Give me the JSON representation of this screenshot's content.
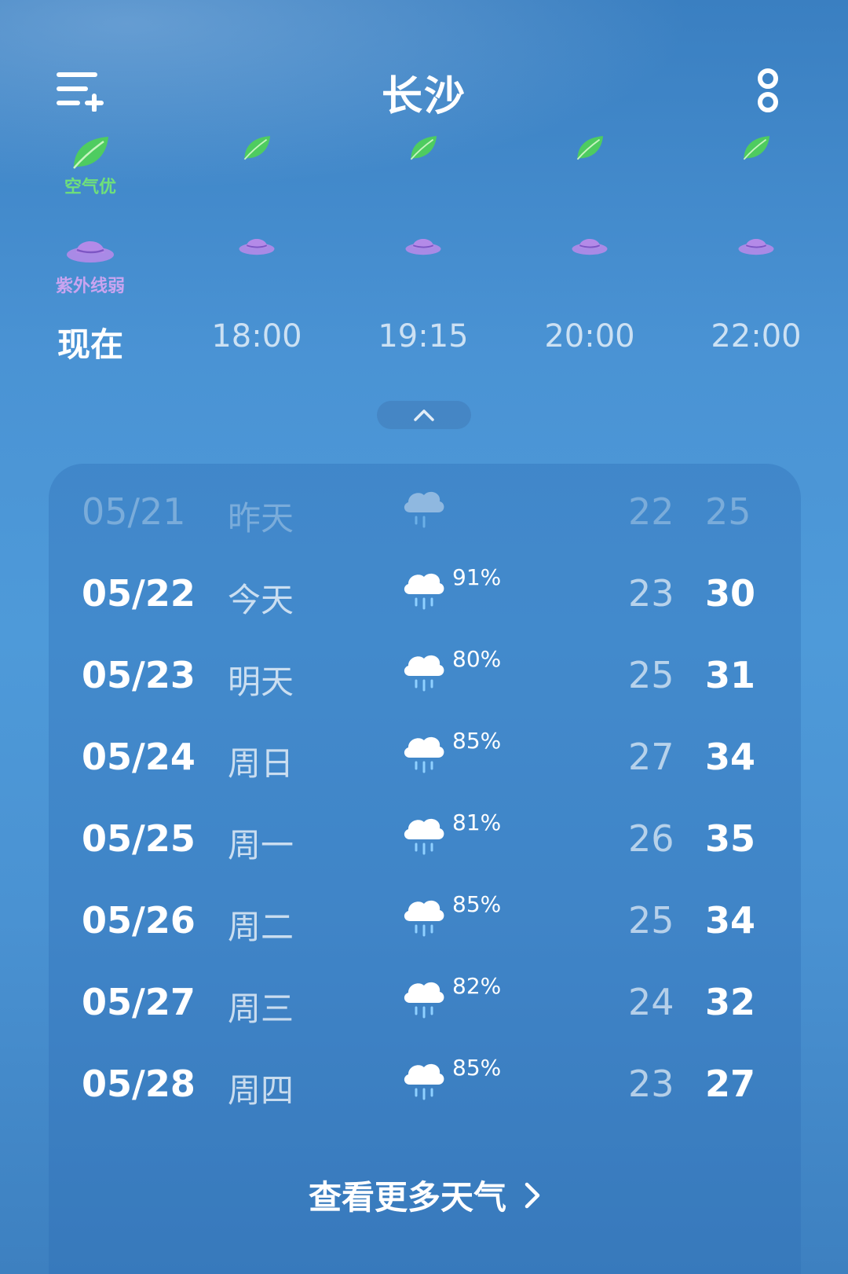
{
  "header": {
    "city": "长沙"
  },
  "hourly": [
    {
      "time": "现在",
      "aq_label": "空气优",
      "uv_label": "紫外线弱",
      "current": true
    },
    {
      "time": "18:00"
    },
    {
      "time": "19:15"
    },
    {
      "time": "20:00"
    },
    {
      "time": "22:00"
    }
  ],
  "forecast": [
    {
      "date": "05/21",
      "day": "昨天",
      "pop": "",
      "low": "22",
      "high": "25",
      "past": true
    },
    {
      "date": "05/22",
      "day": "今天",
      "pop": "91%",
      "low": "23",
      "high": "30"
    },
    {
      "date": "05/23",
      "day": "明天",
      "pop": "80%",
      "low": "25",
      "high": "31"
    },
    {
      "date": "05/24",
      "day": "周日",
      "pop": "85%",
      "low": "27",
      "high": "34"
    },
    {
      "date": "05/25",
      "day": "周一",
      "pop": "81%",
      "low": "26",
      "high": "35"
    },
    {
      "date": "05/26",
      "day": "周二",
      "pop": "85%",
      "low": "25",
      "high": "34"
    },
    {
      "date": "05/27",
      "day": "周三",
      "pop": "82%",
      "low": "24",
      "high": "32"
    },
    {
      "date": "05/28",
      "day": "周四",
      "pop": "85%",
      "low": "23",
      "high": "27"
    }
  ],
  "footer": {
    "more_label": "查看更多天气"
  },
  "colors": {
    "air_quality": "#6fe07a",
    "uv": "#c9a4f0",
    "leaf": "#4fd05a",
    "hat": "#b48ae8"
  },
  "icons": {
    "menu": "menu-add-icon",
    "more": "more-vertical-icon",
    "collapse": "chevron-up-icon",
    "weather": "rain-cloud-icon",
    "aq": "leaf-icon",
    "uv": "hat-icon",
    "chevron": "chevron-right-icon"
  }
}
